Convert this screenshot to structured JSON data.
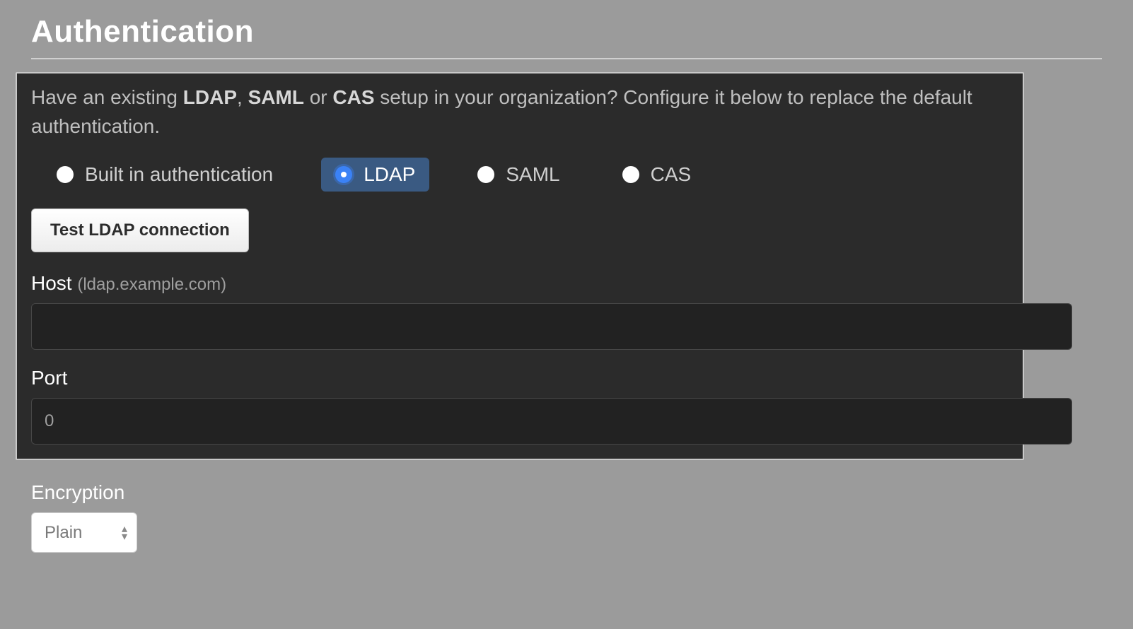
{
  "page": {
    "title": "Authentication"
  },
  "description": {
    "prefix": "Have an existing ",
    "strong1": "LDAP",
    "sep1": ", ",
    "strong2": "SAML",
    "sep2": " or ",
    "strong3": "CAS",
    "suffix": " setup in your organization? Configure it below to replace the default authentication."
  },
  "auth_options": {
    "builtin": "Built in authentication",
    "ldap": "LDAP",
    "saml": "SAML",
    "cas": "CAS",
    "selected": "ldap"
  },
  "buttons": {
    "test_ldap": "Test LDAP connection"
  },
  "fields": {
    "host": {
      "label": "Host",
      "hint": "(ldap.example.com)",
      "value": ""
    },
    "port": {
      "label": "Port",
      "value": "0"
    },
    "encryption": {
      "label": "Encryption",
      "selected": "Plain",
      "options": [
        "Plain"
      ]
    }
  }
}
